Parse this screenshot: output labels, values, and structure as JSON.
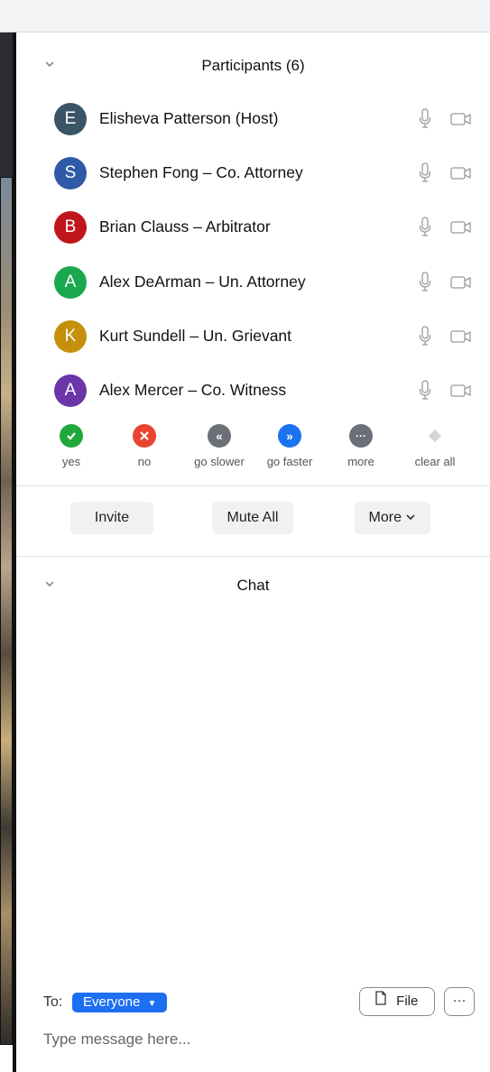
{
  "participants_panel": {
    "title": "Participants (6)",
    "participants": [
      {
        "initial": "E",
        "name": "Elisheva Patterson (Host)",
        "color": "#3a5566"
      },
      {
        "initial": "S",
        "name": "Stephen Fong – Co. Attorney",
        "color": "#2f5aa8"
      },
      {
        "initial": "B",
        "name": "Brian Clauss – Arbitrator",
        "color": "#c0161b"
      },
      {
        "initial": "A",
        "name": "Alex DeArman – Un. Attorney",
        "color": "#1aa84e"
      },
      {
        "initial": "K",
        "name": "Kurt Sundell – Un. Grievant",
        "color": "#c6900c"
      },
      {
        "initial": "A",
        "name": "Alex Mercer – Co. Witness",
        "color": "#6a36a8"
      }
    ],
    "feedback": [
      {
        "label": "yes",
        "icon": "check-icon",
        "color": "#20a83a"
      },
      {
        "label": "no",
        "icon": "x-icon",
        "color": "#e8442f"
      },
      {
        "label": "go slower",
        "icon": "rewind-icon",
        "color": "#6d6f78"
      },
      {
        "label": "go faster",
        "icon": "fast-forward-icon",
        "color": "#1c73f0"
      },
      {
        "label": "more",
        "icon": "ellipsis-icon",
        "color": "#6d6f78"
      },
      {
        "label": "clear all",
        "icon": "eraser-icon",
        "color": "#d3d4d8"
      }
    ],
    "buttons": {
      "invite": "Invite",
      "mute_all": "Mute All",
      "more": "More"
    }
  },
  "chat_panel": {
    "title": "Chat",
    "to_label": "To:",
    "recipient": "Everyone",
    "file_label": "File",
    "more_label": "···",
    "placeholder": "Type message here..."
  }
}
